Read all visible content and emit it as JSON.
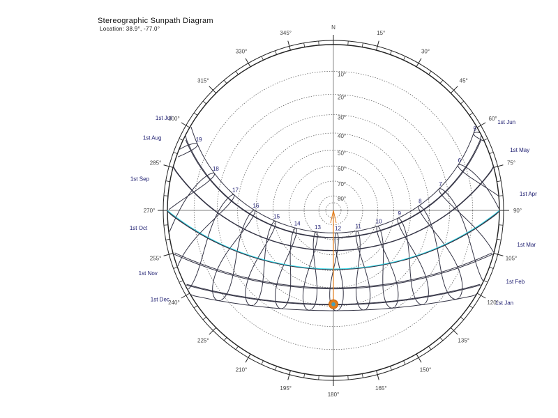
{
  "title": "Stereographic Sunpath Diagram",
  "location_label": "Location: 38.9°, -77.0°",
  "north_label": "N",
  "colors": {
    "frame": "#222222",
    "paths": "#333344",
    "grid": "#666666",
    "equinox": "#33d6e6",
    "hour_labels": "#1a1a6e",
    "month_labels": "#1a1a6e",
    "degree_labels": "#444444",
    "sun_marker": "#e07b1a",
    "sun_center": "#4aa0b5"
  },
  "azimuth_labels": [
    "15°",
    "30°",
    "45°",
    "60°",
    "75°",
    "90°",
    "105°",
    "120°",
    "135°",
    "150°",
    "165°",
    "180°",
    "195°",
    "210°",
    "225°",
    "240°",
    "255°",
    "270°",
    "285°",
    "300°",
    "315°",
    "330°",
    "345°"
  ],
  "altitude_labels": [
    "10°",
    "20°",
    "30°",
    "40°",
    "50°",
    "60°",
    "70°",
    "80°"
  ],
  "month_labels_left": [
    "1st Jul",
    "1st Aug",
    "1st Sep",
    "1st Oct",
    "1st Nov",
    "1st Dec"
  ],
  "month_labels_right": [
    "1st Jun",
    "1st May",
    "1st Apr",
    "1st Mar",
    "1st Feb",
    "1st Jan"
  ],
  "hour_labels": [
    "5",
    "6",
    "7",
    "8",
    "9",
    "10",
    "11",
    "12",
    "13",
    "14",
    "15",
    "16",
    "17",
    "18",
    "19"
  ],
  "location": {
    "latitude": 38.9,
    "longitude": -77.0
  },
  "current_sun": {
    "azimuth": 180,
    "altitude": 31
  }
}
